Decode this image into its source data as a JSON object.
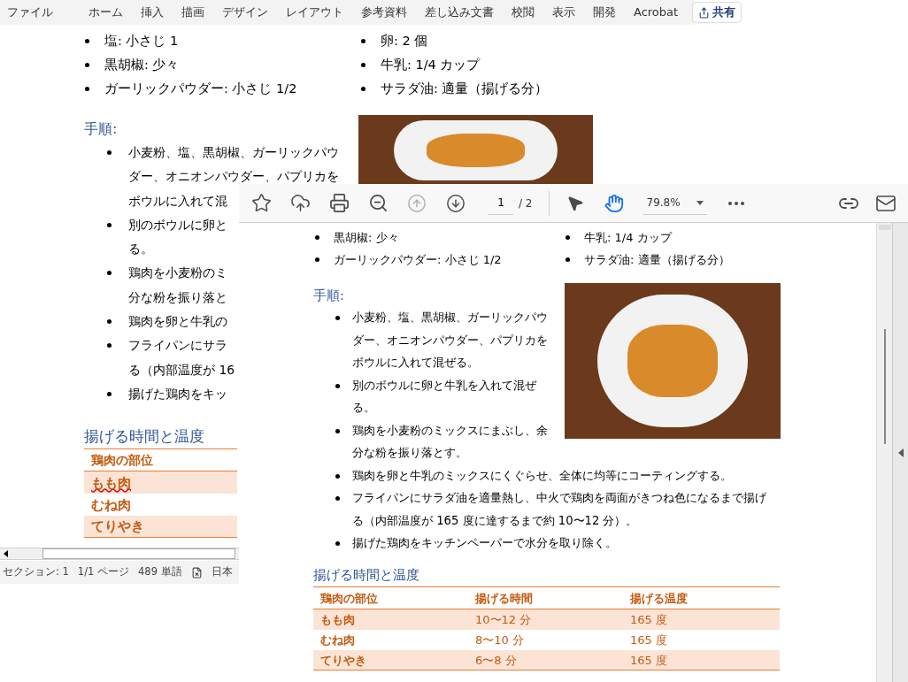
{
  "word": {
    "ribbon_tabs": [
      "ファイル",
      "ホーム",
      "挿入",
      "描画",
      "デザイン",
      "レイアウト",
      "参考資料",
      "差し込み文書",
      "校閲",
      "表示",
      "開発",
      "Acrobat"
    ],
    "share_button": "共有",
    "ingredients": {
      "left": [
        "塩: 小さじ 1",
        "黒胡椒: 少々",
        "ガーリックパウダー: 小さじ 1/2"
      ],
      "right": [
        "卵: 2 個",
        "牛乳: 1/4 カップ",
        "サラダ油: 適量（揚げる分）"
      ]
    },
    "steps_heading": "手順:",
    "steps": [
      {
        "lines": [
          "小麦粉、塩、黒胡椒、ガーリックパウ",
          "ダー、オニオンパウダー、パプリカを",
          "ボウルに入れて混"
        ]
      },
      {
        "lines": [
          "別のボウルに卵と",
          "る。"
        ]
      },
      {
        "lines": [
          "鶏肉を小麦粉のミ",
          "分な粉を振り落と"
        ]
      },
      {
        "lines": [
          "鶏肉を卵と牛乳の"
        ]
      },
      {
        "lines": [
          "フライパンにサラ",
          "る（内部温度が 16"
        ]
      },
      {
        "lines": [
          "揚げた鶏肉をキッ"
        ]
      }
    ],
    "table_heading": "揚げる時間と温度",
    "table": {
      "header": "鶏肉の部位",
      "rows": [
        {
          "cell": "もも肉",
          "shaded": true,
          "spelling_error": true
        },
        {
          "cell": "むね肉",
          "shaded": false,
          "spelling_error": false
        },
        {
          "cell": "てりやき",
          "shaded": true,
          "spelling_error": false
        }
      ]
    },
    "status_bar": {
      "section": "セクション: 1",
      "page": "1/1 ページ",
      "words": "489 単語",
      "language": "日本"
    }
  },
  "pdf": {
    "toolbar": {
      "previous_page": {
        "disabled": true
      },
      "next_page": {
        "disabled": false
      },
      "page": "1",
      "page_total": "/ 2",
      "tools": [
        {
          "kind": "select",
          "selected": false
        },
        {
          "kind": "hand",
          "selected": true
        }
      ],
      "zoom": "79.8%"
    },
    "ingredients": {
      "left": [
        "黒胡椒: 少々",
        "ガーリックパウダー: 小さじ 1/2"
      ],
      "right": [
        "牛乳: 1/4 カップ",
        "サラダ油: 適量（揚げる分）"
      ]
    },
    "steps_heading": "手順:",
    "steps": [
      {
        "lines": [
          "小麦粉、塩、黒胡椒、ガーリックパウ",
          "ダー、オニオンパウダー、パプリカを",
          "ボウルに入れて混ぜる。"
        ]
      },
      {
        "lines": [
          "別のボウルに卵と牛乳を入れて混ぜ",
          "る。"
        ]
      },
      {
        "lines": [
          "鶏肉を小麦粉のミックスにまぶし、余",
          "分な粉を振り落とす。"
        ]
      },
      {
        "lines": [
          "鶏肉を卵と牛乳のミックスにくぐらせ、全体に均等にコーティングする。"
        ]
      },
      {
        "lines": [
          "フライパンにサラダ油を適量熱し、中火で鶏肉を両面がきつね色になるまで揚げ",
          "る（内部温度が 165 度に達するまで約 10〜12 分）。"
        ]
      },
      {
        "lines": [
          "揚げた鶏肉をキッチンペーパーで水分を取り除く。"
        ]
      }
    ],
    "table_heading": "揚げる時間と温度",
    "table": {
      "columns": [
        "鶏肉の部位",
        "揚げる時間",
        "揚げる温度"
      ],
      "rows": [
        {
          "cells": [
            "もも肉",
            "10〜12 分",
            "165 度"
          ],
          "shaded": true
        },
        {
          "cells": [
            "むね肉",
            "8〜10 分",
            "165 度"
          ],
          "shaded": false
        },
        {
          "cells": [
            "てりやき",
            "6〜8 分",
            "165 度"
          ],
          "shaded": true
        }
      ]
    }
  }
}
